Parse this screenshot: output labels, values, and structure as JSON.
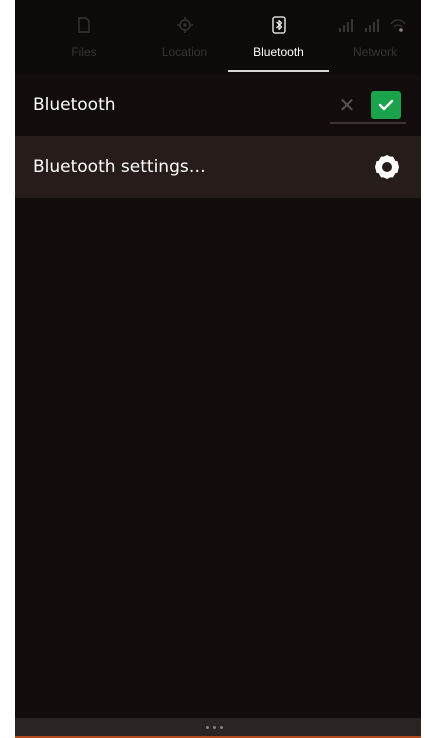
{
  "tabs": [
    {
      "label": "Files",
      "icon": "files-icon",
      "active": false
    },
    {
      "label": "Location",
      "icon": "location-icon",
      "active": false
    },
    {
      "label": "Bluetooth",
      "icon": "bluetooth-icon",
      "active": true
    },
    {
      "label": "Network",
      "icon": "network-signal-icon",
      "active": false
    }
  ],
  "bluetooth_row": {
    "label": "Bluetooth",
    "enabled": true
  },
  "settings_row": {
    "label": "Bluetooth settings…",
    "icon": "gear-icon"
  },
  "colors": {
    "background": "#120d0c",
    "selected_row": "#261d1a",
    "toggle_on": "#1aa34a",
    "accent_edge": "#b54a1f"
  }
}
